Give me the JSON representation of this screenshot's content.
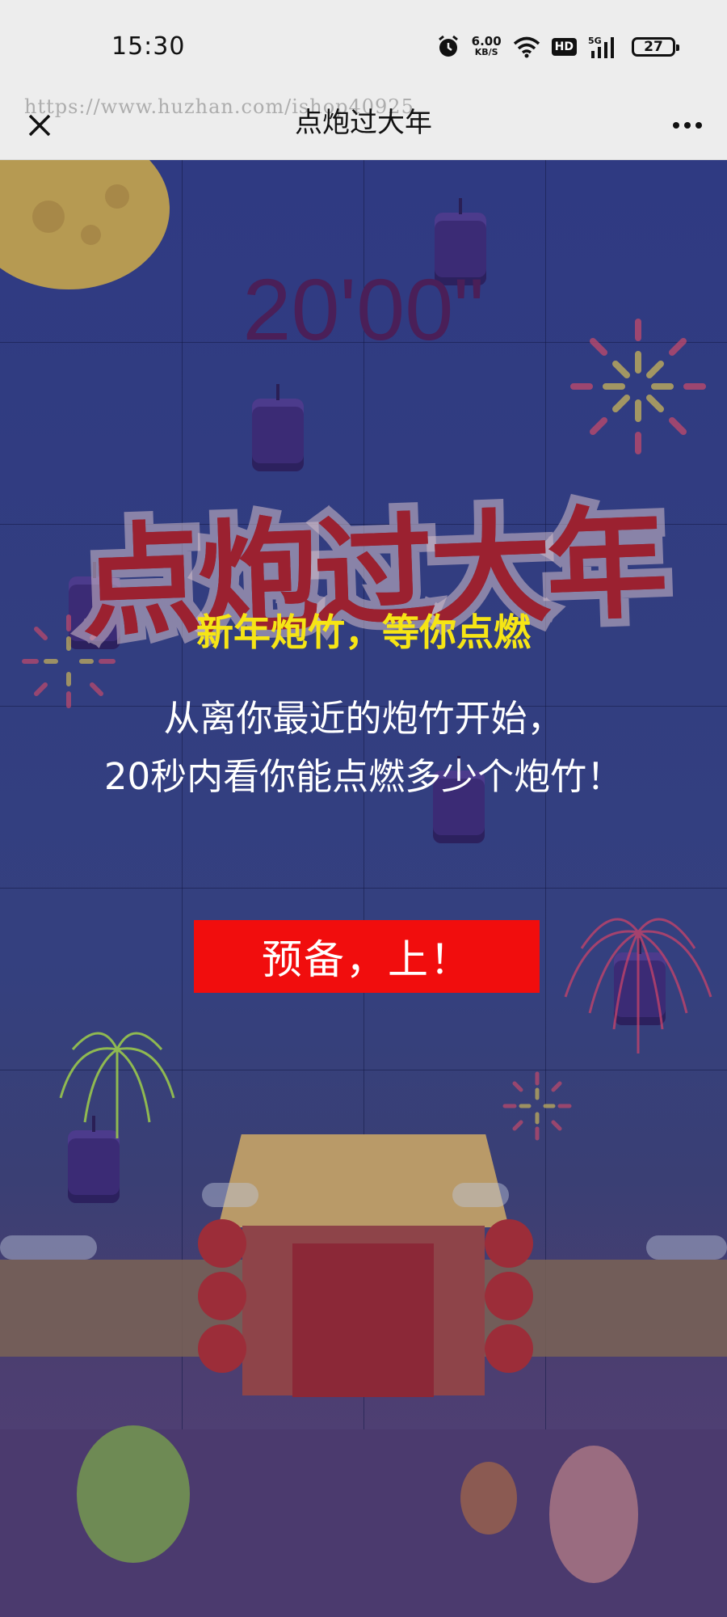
{
  "status_bar": {
    "time": "15:30",
    "net_speed_value": "6.00",
    "net_speed_unit": "KB/S",
    "hd_label": "HD",
    "battery_level": "27"
  },
  "nav": {
    "title": "点炮过大年",
    "watermark": "https://www.huzhan.com/ishop40925"
  },
  "game": {
    "timer": "20'00\"",
    "logo_title": "点炮过大年",
    "subtitle": "新年炮竹，等你点燃",
    "description_lines": [
      "从离你最近的炮竹开始，",
      "20秒内看你能点燃多少个炮竹！"
    ],
    "start_button": "预备，上！"
  },
  "colors": {
    "background": "#2f3a82",
    "subtitle": "#f6e515",
    "button": "#f10d0d",
    "timer": "#4a1f58"
  },
  "icons": {
    "close": "close-icon",
    "more": "more-icon",
    "alarm": "alarm-icon",
    "wifi": "wifi-icon",
    "signal": "signal-icon",
    "battery": "battery-icon"
  }
}
